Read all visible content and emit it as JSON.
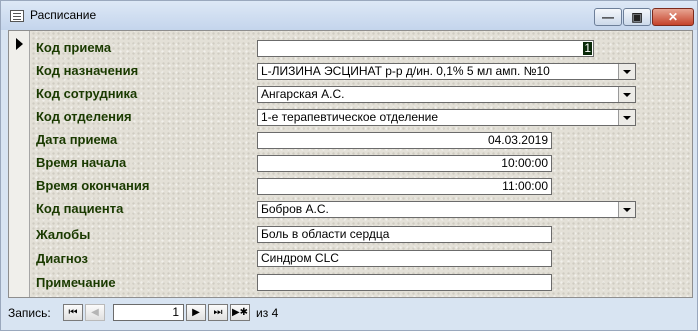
{
  "window": {
    "title": "Расписание",
    "minimize_glyph": "—",
    "restore_glyph": "▣",
    "close_glyph": "✕"
  },
  "form": {
    "fields": [
      {
        "label": "Код приема",
        "value": "1",
        "type": "text-cursor"
      },
      {
        "label": "Код назначения",
        "value": "L-ЛИЗИНА ЭСЦИНАТ р-р д/ин. 0,1% 5 мл амп. №10",
        "type": "combo"
      },
      {
        "label": "Код сотрудника",
        "value": "Ангарская А.С.",
        "type": "combo"
      },
      {
        "label": "Код отделения",
        "value": "1-е терапевтическое отделение",
        "type": "combo"
      },
      {
        "label": "Дата приема",
        "value": "04.03.2019",
        "type": "right"
      },
      {
        "label": "Время начала",
        "value": "10:00:00",
        "type": "right"
      },
      {
        "label": "Время окончания",
        "value": "11:00:00",
        "type": "right"
      },
      {
        "label": "Код пациента",
        "value": "Бобров А.С.",
        "type": "combo"
      },
      {
        "label": "Жалобы",
        "value": "Боль в области сердца",
        "type": "text"
      },
      {
        "label": "Диагноз",
        "value": "Синдром CLC",
        "type": "text"
      },
      {
        "label": "Примечание",
        "value": "",
        "type": "text"
      }
    ]
  },
  "navigation": {
    "label": "Запись:",
    "current": "1",
    "of_label": "из",
    "total": "4",
    "first_glyph": "⏮",
    "prev_glyph": "◀",
    "next_glyph": "▶",
    "last_glyph": "⏭",
    "new_glyph": "▶✱"
  }
}
